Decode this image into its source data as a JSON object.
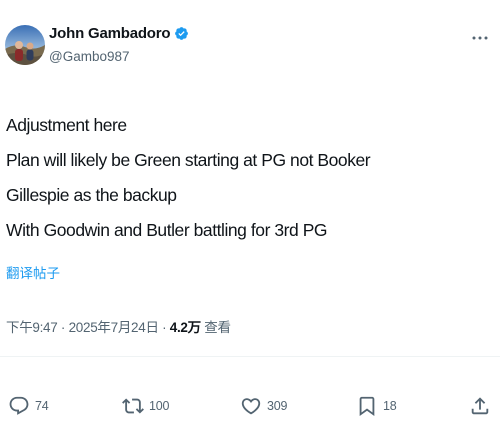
{
  "author": {
    "display_name": "John Gambadoro",
    "handle": "@Gambo987",
    "verified": true
  },
  "tweet": {
    "lines": [
      "Adjustment here",
      "Plan will likely be Green starting at PG not Booker",
      "Gillespie as the backup",
      "With Goodwin and Butler battling for 3rd PG"
    ],
    "translate_label": "翻译帖子"
  },
  "meta": {
    "time": "下午9:47",
    "separator": " · ",
    "date": "2025年7月24日",
    "views_count": "4.2万",
    "views_label": "查看"
  },
  "actions": {
    "replies": "74",
    "reposts": "100",
    "likes": "309",
    "bookmarks": "18"
  },
  "colors": {
    "text": "#0f1419",
    "secondary": "#536471",
    "accent": "#1d9bf0",
    "divider": "#eff3f4"
  },
  "icons": [
    "verified-badge-icon",
    "more-icon",
    "reply-icon",
    "repost-icon",
    "like-icon",
    "bookmark-icon",
    "share-icon"
  ]
}
